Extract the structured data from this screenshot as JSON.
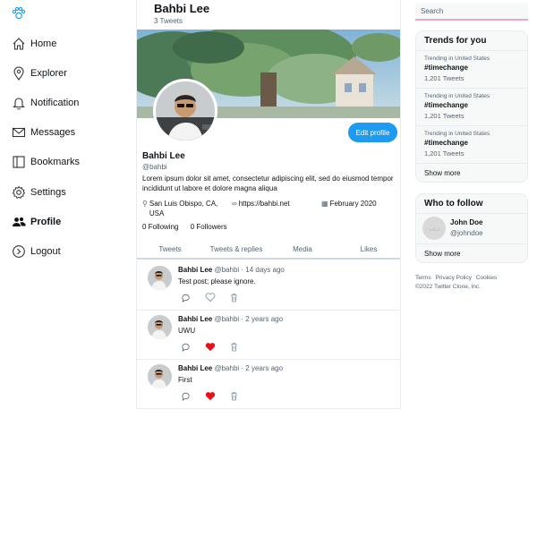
{
  "sidebar": {
    "logo_icon": "paw-icon",
    "items": [
      {
        "label": "Home",
        "icon": "home-icon"
      },
      {
        "label": "Explorer",
        "icon": "location-pin-icon"
      },
      {
        "label": "Notification",
        "icon": "bell-icon"
      },
      {
        "label": "Messages",
        "icon": "envelope-icon"
      },
      {
        "label": "Bookmarks",
        "icon": "book-icon"
      },
      {
        "label": "Settings",
        "icon": "gear-icon"
      },
      {
        "label": "Profile",
        "icon": "users-icon",
        "active": true
      },
      {
        "label": "Logout",
        "icon": "logout-icon"
      }
    ]
  },
  "header": {
    "name": "Bahbi Lee",
    "tweet_count": "3 Tweets"
  },
  "profile": {
    "name": "Bahbi Lee",
    "handle": "@bahbi",
    "bio": "Lorem ipsum dolor sit amet, consectetur adipiscing elit, sed do eiusmod tempor incididunt ut labore et dolore magna aliqua",
    "location": "San Luis Obispo, CA, USA",
    "website": "https://bahbi.net",
    "joined": "February 2020",
    "following": "0 Following",
    "followers": "0 Followers",
    "edit_label": "Edit profile"
  },
  "tabs": [
    "Tweets",
    "Tweets & replies",
    "Media",
    "Likes"
  ],
  "tweets": [
    {
      "name": "Bahbi Lee",
      "meta": "@bahbi · 14 days ago",
      "text": "Test post; please ignore.",
      "liked": false
    },
    {
      "name": "Bahbi Lee",
      "meta": "@bahbi · 2 years ago",
      "text": "UWU",
      "liked": true
    },
    {
      "name": "Bahbi Lee",
      "meta": "@bahbi · 2 years ago",
      "text": "First",
      "liked": true
    }
  ],
  "search": {
    "placeholder": "Search"
  },
  "trends": {
    "title": "Trends for you",
    "items": [
      {
        "context": "Trending in United States",
        "tag": "#timechange",
        "count": "1,201 Tweets"
      },
      {
        "context": "Trending in United States",
        "tag": "#timechange",
        "count": "1,201 Tweets"
      },
      {
        "context": "Trending in United States",
        "tag": "#timechange",
        "count": "1,201 Tweets"
      }
    ],
    "show_more": "Show more"
  },
  "who_to_follow": {
    "title": "Who to follow",
    "users": [
      {
        "name": "John Doe",
        "handle": "@johndoe"
      }
    ],
    "show_more": "Show more"
  },
  "footer": {
    "links": [
      "Terms",
      "Privacy Policy",
      "Cookies"
    ],
    "copyright": "©2022 Twitter Clone, Inc."
  },
  "colors": {
    "accent": "#1d9bf0",
    "like": "#f91880",
    "heart_red": "#e0245e",
    "search_underline": "#f4a5b8"
  }
}
